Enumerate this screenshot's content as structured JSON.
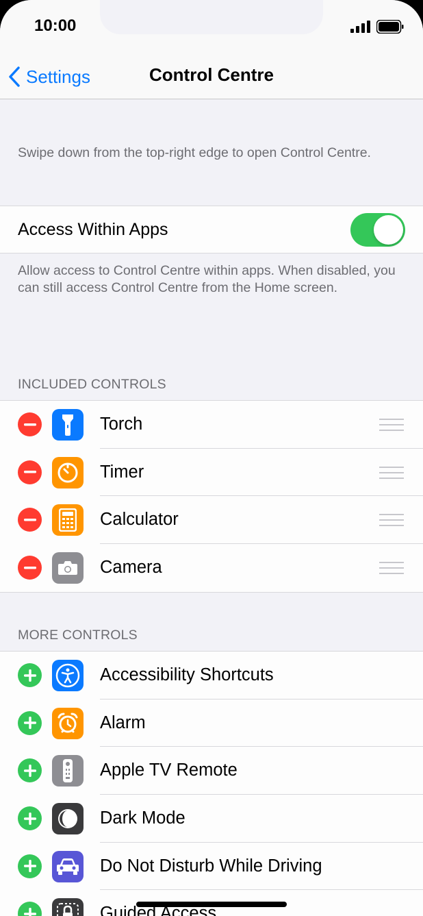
{
  "status_bar": {
    "time": "10:00"
  },
  "nav": {
    "back_label": "Settings",
    "title": "Control Centre"
  },
  "intro_note": "Swipe down from the top-right edge to open Control Centre.",
  "access_within_apps": {
    "label": "Access Within Apps",
    "enabled": true,
    "footer": "Allow access to Control Centre within apps. When disabled, you can still access Control Centre from the Home screen."
  },
  "included": {
    "header": "INCLUDED CONTROLS",
    "items": [
      {
        "label": "Torch",
        "icon": "torch-icon",
        "color": "#0a7aff"
      },
      {
        "label": "Timer",
        "icon": "timer-icon",
        "color": "#ff9500"
      },
      {
        "label": "Calculator",
        "icon": "calculator-icon",
        "color": "#ff9500"
      },
      {
        "label": "Camera",
        "icon": "camera-icon",
        "color": "#8e8e93"
      }
    ]
  },
  "more": {
    "header": "MORE CONTROLS",
    "items": [
      {
        "label": "Accessibility Shortcuts",
        "icon": "accessibility-icon",
        "color": "#0a7aff"
      },
      {
        "label": "Alarm",
        "icon": "alarm-icon",
        "color": "#ff9500"
      },
      {
        "label": "Apple TV Remote",
        "icon": "remote-icon",
        "color": "#8e8e93"
      },
      {
        "label": "Dark Mode",
        "icon": "dark-mode-icon",
        "color": "#3a3a3c"
      },
      {
        "label": "Do Not Disturb While Driving",
        "icon": "car-icon",
        "color": "#5856d6"
      },
      {
        "label": "Guided Access",
        "icon": "lock-icon",
        "color": "#3a3a3c"
      }
    ]
  }
}
